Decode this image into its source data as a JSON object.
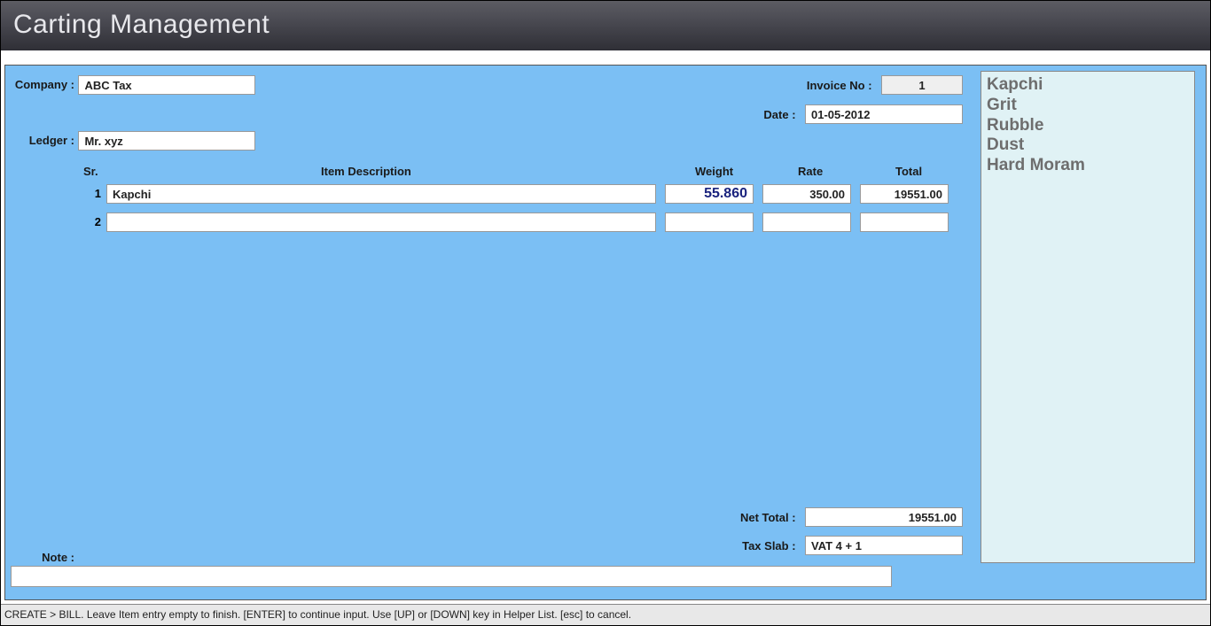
{
  "title": "Carting Management",
  "form": {
    "company_label": "Company :",
    "company_value": "ABC Tax",
    "ledger_label": "Ledger :",
    "ledger_value": "Mr. xyz",
    "invoice_label": "Invoice No :",
    "invoice_value": "1",
    "date_label": "Date :",
    "date_value": "01-05-2012",
    "nettotal_label": "Net Total :",
    "nettotal_value": "19551.00",
    "taxslab_label": "Tax Slab :",
    "taxslab_value": "VAT 4 + 1",
    "note_label": "Note :",
    "note_value": ""
  },
  "columns": {
    "sr": "Sr.",
    "desc": "Item Description",
    "weight": "Weight",
    "rate": "Rate",
    "total": "Total"
  },
  "rows": [
    {
      "sr": "1",
      "desc": "Kapchi",
      "weight": "55.860",
      "rate": "350.00",
      "total": "19551.00"
    },
    {
      "sr": "2",
      "desc": "",
      "weight": "",
      "rate": "",
      "total": ""
    }
  ],
  "helper": {
    "items": [
      "Kapchi",
      "Grit",
      "Rubble",
      "Dust",
      "Hard Moram"
    ]
  },
  "status": "CREATE > BILL. Leave Item entry empty to finish. [ENTER] to continue input. Use [UP] or [DOWN] key in Helper List. [esc] to cancel."
}
